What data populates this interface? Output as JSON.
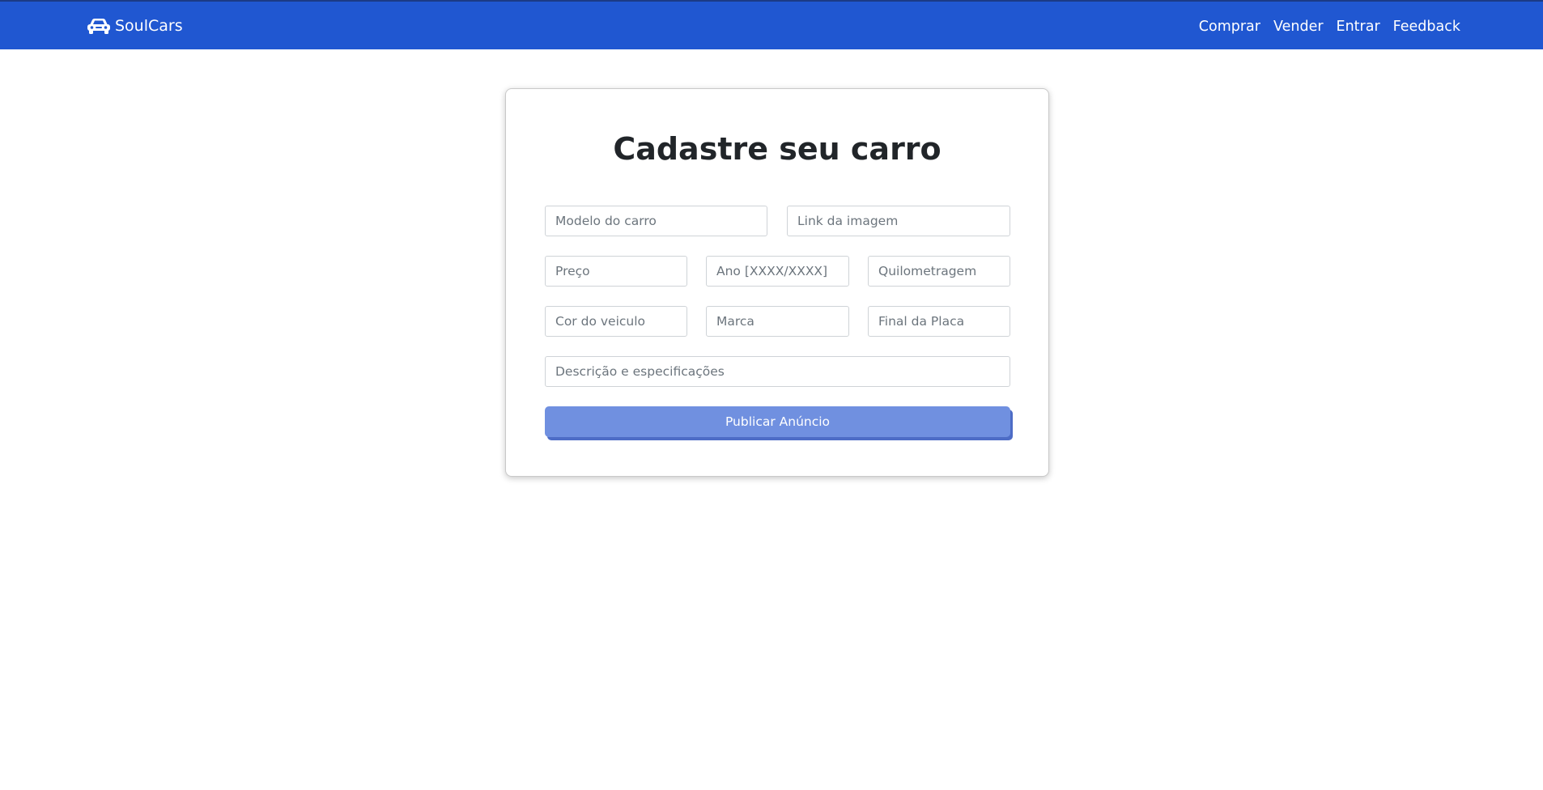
{
  "app": {
    "brand_name": "SoulCars",
    "brand_icon": "car-icon"
  },
  "nav": {
    "items": [
      {
        "label": "Comprar"
      },
      {
        "label": "Vender"
      },
      {
        "label": "Entrar"
      },
      {
        "label": "Feedback"
      }
    ]
  },
  "form": {
    "title": "Cadastre seu carro",
    "fields": {
      "modelo": {
        "placeholder": "Modelo do carro",
        "value": ""
      },
      "imagem": {
        "placeholder": "Link da imagem",
        "value": ""
      },
      "preco": {
        "placeholder": "Preço",
        "value": ""
      },
      "ano": {
        "placeholder": "Ano [XXXX/XXXX]",
        "value": ""
      },
      "quilometragem": {
        "placeholder": "Quilometragem",
        "value": ""
      },
      "cor": {
        "placeholder": "Cor do veiculo",
        "value": ""
      },
      "marca": {
        "placeholder": "Marca",
        "value": ""
      },
      "placa": {
        "placeholder": "Final da Placa",
        "value": ""
      },
      "descricao": {
        "placeholder": "Descrição e especificações",
        "value": ""
      }
    },
    "submit_label": "Publicar Anúncio"
  },
  "colors": {
    "navbar": "#2057d1",
    "button": "#7090e0",
    "button_shadow": "#4d6cc6",
    "title_text": "#212529"
  }
}
